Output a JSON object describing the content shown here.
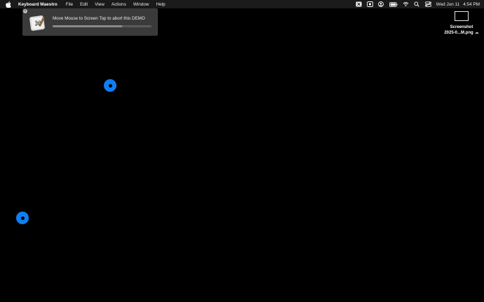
{
  "menubar": {
    "app_name": "Keyboard Maestro",
    "items": [
      {
        "label": "File"
      },
      {
        "label": "Edit"
      },
      {
        "label": "View"
      },
      {
        "label": "Actions"
      },
      {
        "label": "Window"
      },
      {
        "label": "Help"
      }
    ],
    "status_icons": [
      "keyboard-maestro-status-icon",
      "record-icon",
      "user-icon",
      "battery-icon",
      "wifi-icon",
      "search-icon",
      "control-center-icon"
    ],
    "date": "Wed Jun 11",
    "time": "4:54 PM"
  },
  "notification": {
    "message": "Move Mouse to Screen Top to abort this DEMO",
    "progress": 0.7,
    "icon": "keyboard-maestro-icon"
  },
  "desktop_file": {
    "name_line1": "Screenshot",
    "name_line2": "2025-0...M.png",
    "icon": "icloud-icon"
  },
  "colors": {
    "accent": "#0f7ef4",
    "background": "#000000",
    "notification_bg": "#3a3a3a"
  }
}
